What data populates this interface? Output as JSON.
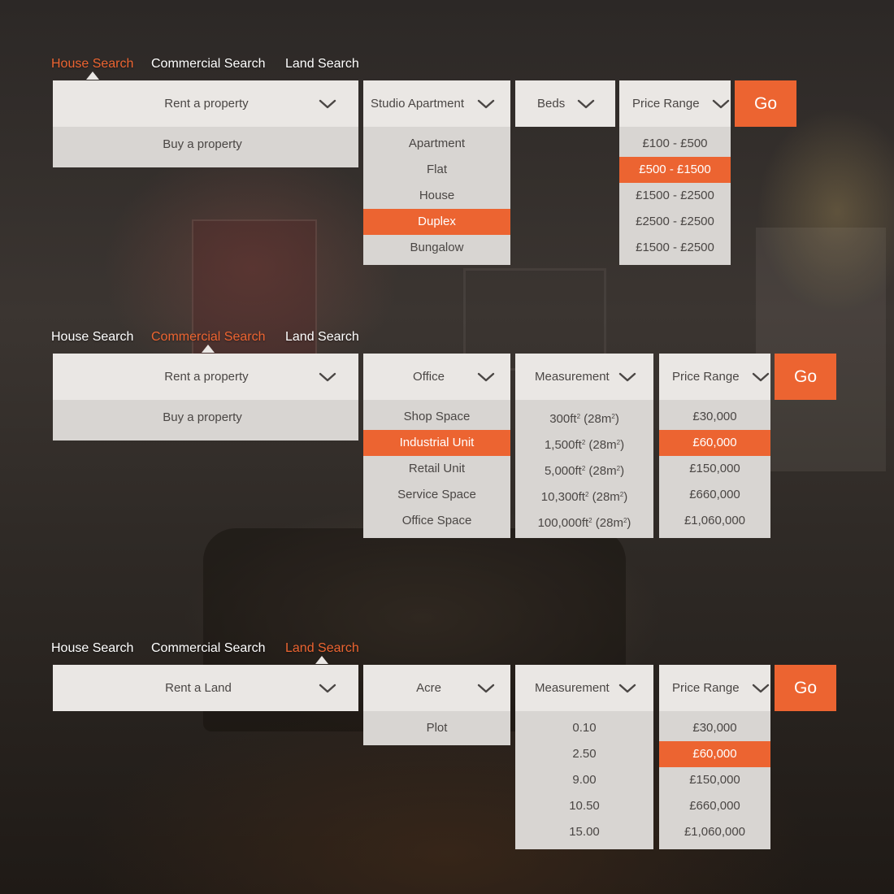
{
  "colors": {
    "accent": "#ec6431",
    "dropdown": "#eae7e4",
    "list": "#d8d5d2",
    "text": "#4a4644"
  },
  "tabs": [
    "House Search",
    "Commercial Search",
    "Land Search"
  ],
  "house": {
    "active_tab": "House Search",
    "purpose": {
      "selected": "Rent a property",
      "options": [
        "Buy a property"
      ]
    },
    "type": {
      "selected": "Studio Apartment",
      "options": [
        "Apartment",
        "Flat",
        "House",
        "Duplex",
        "Bungalow"
      ],
      "highlighted": "Duplex"
    },
    "beds": {
      "selected": "Beds"
    },
    "price": {
      "selected": "Price Range",
      "options": [
        "£100 - £500",
        "£500 - £1500",
        "£1500 - £2500",
        "£2500 - £2500",
        "£1500 - £2500"
      ],
      "highlighted": "£500 - £1500"
    },
    "go": "Go"
  },
  "commercial": {
    "active_tab": "Commercial Search",
    "purpose": {
      "selected": "Rent a property",
      "options": [
        "Buy a property"
      ]
    },
    "type": {
      "selected": "Office",
      "options": [
        "Shop Space",
        "Industrial Unit",
        "Retail Unit",
        "Service Space",
        "Office Space"
      ],
      "highlighted": "Industrial Unit"
    },
    "measurement": {
      "selected": "Measurement",
      "options": [
        {
          "num": "300ft",
          "sup": "2",
          "paren": " (28m",
          "sup2": "2",
          "close": ")"
        },
        {
          "num": "1,500ft",
          "sup": "2",
          "paren": " (28m",
          "sup2": "2",
          "close": ")"
        },
        {
          "num": "5,000ft",
          "sup": "2",
          "paren": " (28m",
          "sup2": "2",
          "close": ")"
        },
        {
          "num": "10,300ft",
          "sup": "2",
          "paren": " (28m",
          "sup2": "2",
          "close": ")"
        },
        {
          "num": "100,000ft",
          "sup": "2",
          "paren": " (28m",
          "sup2": "2",
          "close": ")"
        }
      ]
    },
    "price": {
      "selected": "Price Range",
      "options": [
        "£30,000",
        "£60,000",
        "£150,000",
        "£660,000",
        "£1,060,000"
      ],
      "highlighted": "£60,000"
    },
    "go": "Go"
  },
  "land": {
    "active_tab": "Land Search",
    "purpose": {
      "selected": "Rent a Land"
    },
    "unit": {
      "selected": "Acre",
      "options": [
        "Plot"
      ]
    },
    "measurement": {
      "selected": "Measurement",
      "options": [
        "0.10",
        "2.50",
        "9.00",
        "10.50",
        "15.00"
      ]
    },
    "price": {
      "selected": "Price Range",
      "options": [
        "£30,000",
        "£60,000",
        "£150,000",
        "£660,000",
        "£1,060,000"
      ],
      "highlighted": "£60,000"
    },
    "go": "Go"
  }
}
